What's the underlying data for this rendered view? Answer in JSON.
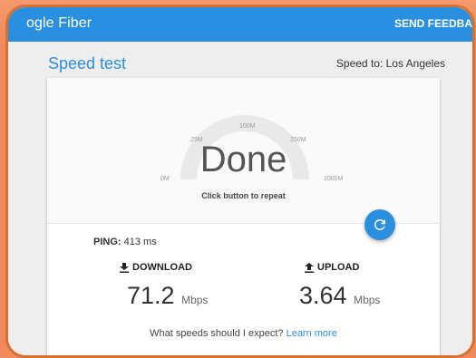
{
  "appbar": {
    "brand": "ogle Fiber",
    "feedback_label": "SEND FEEDBA"
  },
  "page": {
    "title": "Speed test",
    "speed_to": "Speed to: Los Angeles"
  },
  "gauge": {
    "ticks": [
      "0M",
      "25M",
      "100M",
      "250M",
      "1000M"
    ],
    "status": "Done",
    "hint": "Click button to repeat",
    "arc_color": "#e9e9e9"
  },
  "results": {
    "ping_label": "PING:",
    "ping_value": "413 ms",
    "download_label": "DOWNLOAD",
    "download_value": "71.2",
    "download_unit": "Mbps",
    "upload_label": "UPLOAD",
    "upload_value": "3.64",
    "upload_unit": "Mbps"
  },
  "footer": {
    "question": "What speeds should I expect?",
    "link": "Learn more"
  },
  "colors": {
    "accent": "#2b8fe0",
    "frame": "#d8702f"
  }
}
